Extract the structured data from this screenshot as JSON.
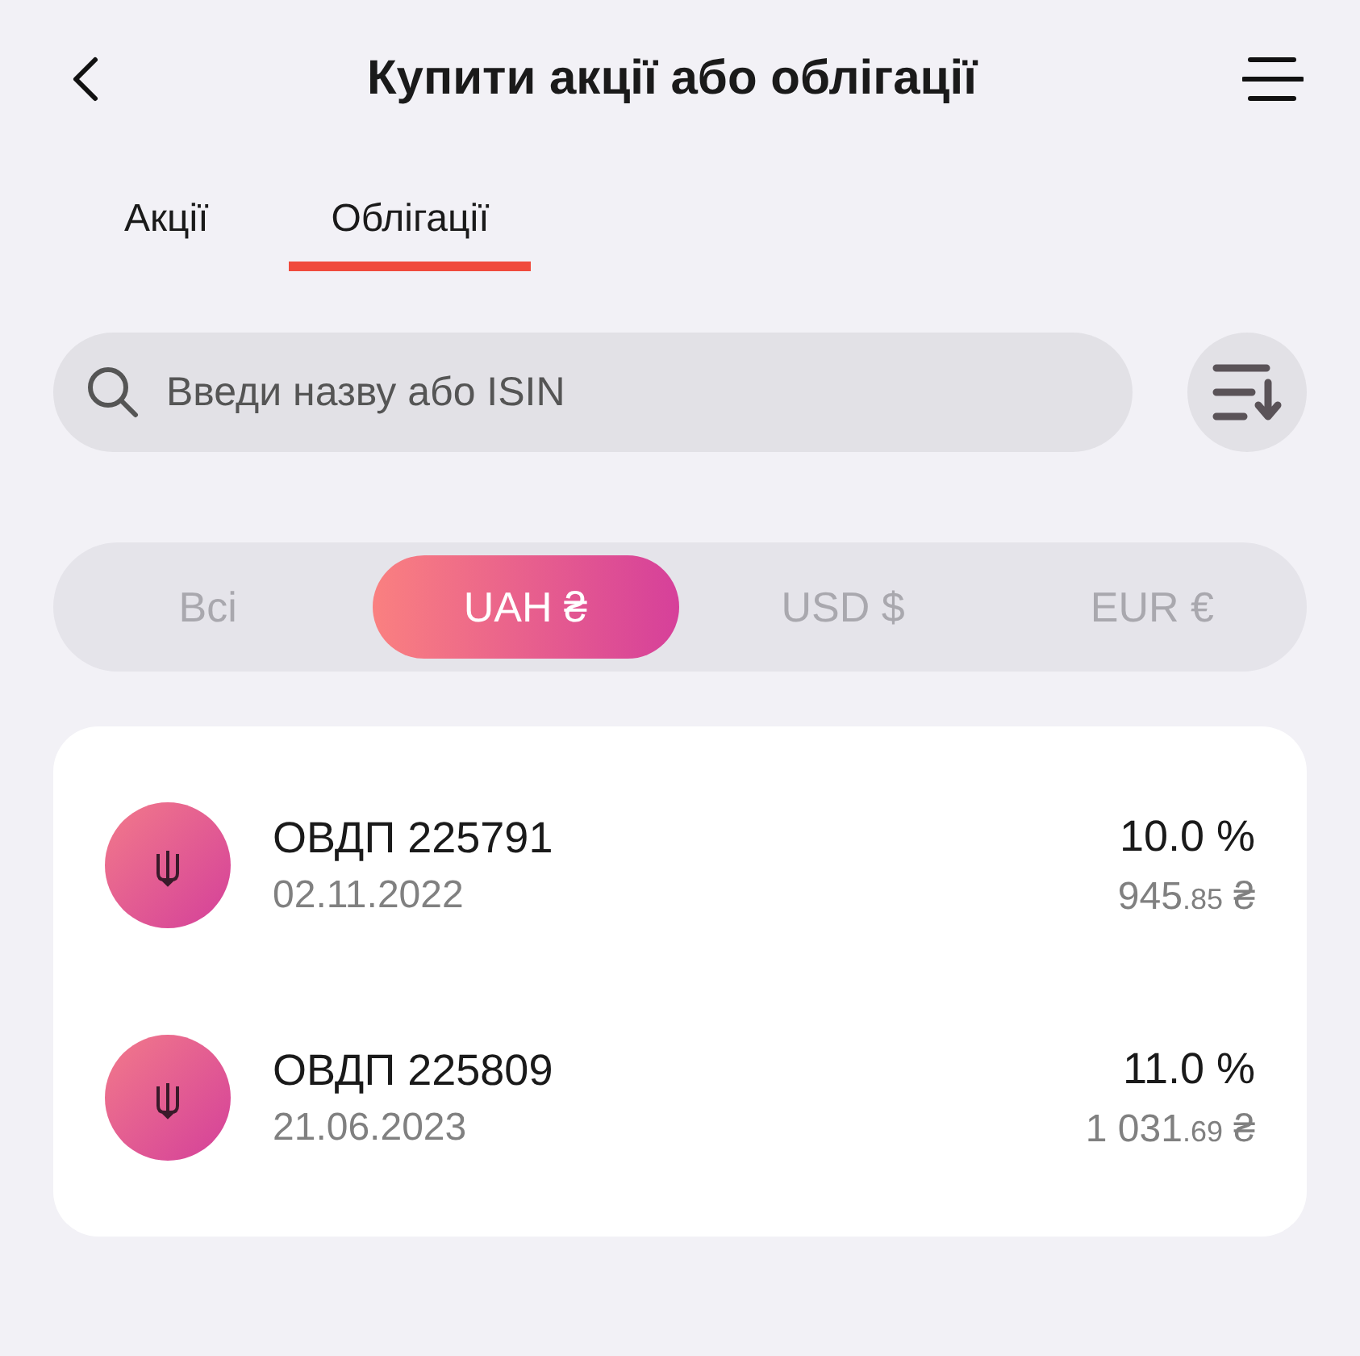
{
  "header": {
    "title": "Купити акції або облігації"
  },
  "tabs": [
    {
      "label": "Акції",
      "selected": false
    },
    {
      "label": "Облігації",
      "selected": true
    }
  ],
  "search": {
    "placeholder": "Введи назву або ISIN"
  },
  "currency_filter": [
    {
      "label": "Всі",
      "selected": false
    },
    {
      "label": "UAH ₴",
      "selected": true
    },
    {
      "label": "USD $",
      "selected": false
    },
    {
      "label": "EUR €",
      "selected": false
    }
  ],
  "bonds": [
    {
      "name": "ОВДП 225791",
      "date": "02.11.2022",
      "yield": "10.0 %",
      "price_whole": "945",
      "price_fraction": ".85",
      "currency": "₴"
    },
    {
      "name": "ОВДП 225809",
      "date": "21.06.2023",
      "yield": "11.0 %",
      "price_whole": "1 031",
      "price_fraction": ".69",
      "currency": "₴"
    }
  ]
}
